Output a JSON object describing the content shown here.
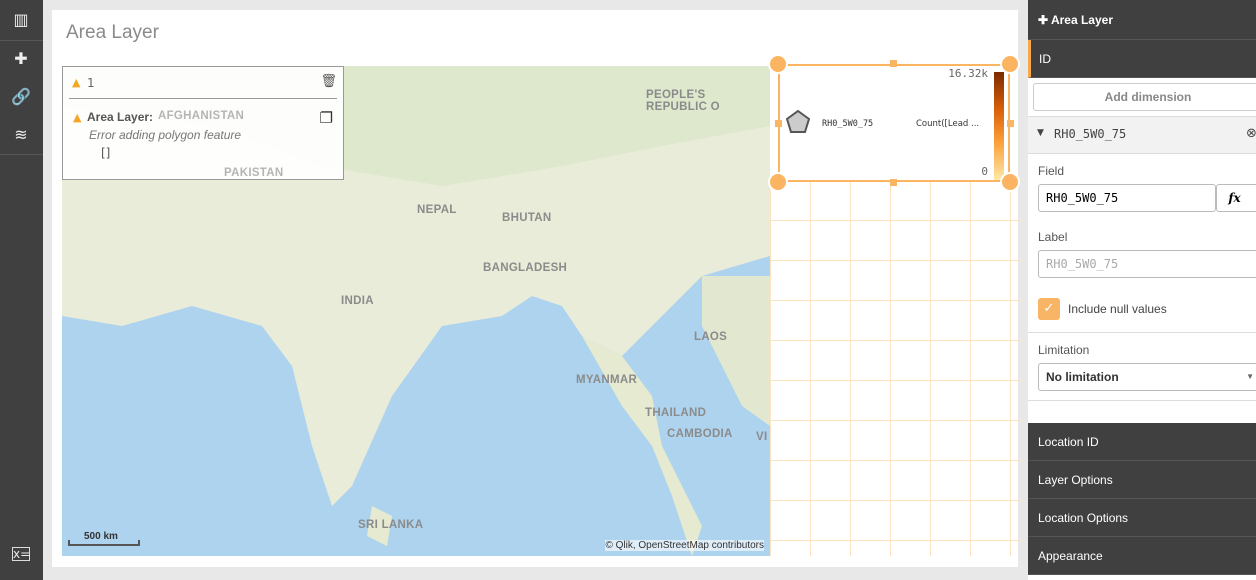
{
  "sidebar": {
    "icons": [
      "chart-icon",
      "puzzle-icon",
      "link-icon",
      "database-icon",
      "variables-icon"
    ]
  },
  "sheet": {
    "title": "Area Layer"
  },
  "map": {
    "labels": [
      "PEOPLE'S REPUBLIC O",
      "NEPAL",
      "BHUTAN",
      "BANGLADESH",
      "INDIA",
      "LAOS",
      "MYANMAR",
      "THAILAND",
      "CAMBODIA",
      "VI",
      "SRI LANKA",
      "AFGHANISTAN",
      "PAKISTAN"
    ],
    "scale": "500 km",
    "attribution": "© Qlik, OpenStreetMap contributors"
  },
  "error_popup": {
    "count": "1",
    "title": "Area Layer:",
    "message": "Error adding polygon feature",
    "detail": "[]"
  },
  "legend": {
    "dimension": "RH0_5W0_75",
    "measure": "Count([Lead ...",
    "max": "16.32k",
    "min": "0",
    "colors": [
      "#7a2a00",
      "#d9600a",
      "#fba03a",
      "#fde8a8"
    ]
  },
  "panel": {
    "header": "Area Layer",
    "section": "ID",
    "add_dimension": "Add dimension",
    "dimension_name": "RH0_5W0_75",
    "field_label": "Field",
    "field_value": "RH0_5W0_75",
    "fx": "fx",
    "label_label": "Label",
    "label_placeholder": "RH0_5W0_75",
    "include_null": "Include null values",
    "include_null_checked": true,
    "limitation_label": "Limitation",
    "limitation_value": "No limitation",
    "sections": [
      "Location ID",
      "Layer Options",
      "Location Options",
      "Appearance"
    ]
  },
  "accent": "#f8a84a"
}
